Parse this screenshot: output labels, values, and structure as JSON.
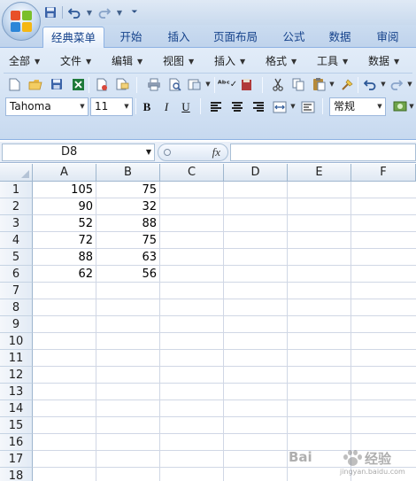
{
  "quick_access": {
    "icons": [
      "save-icon",
      "undo-icon",
      "redo-icon",
      "customize-icon"
    ]
  },
  "tabs": [
    {
      "label": "经典菜单",
      "active": true
    },
    {
      "label": "开始",
      "active": false
    },
    {
      "label": "插入",
      "active": false
    },
    {
      "label": "页面布局",
      "active": false
    },
    {
      "label": "公式",
      "active": false
    },
    {
      "label": "数据",
      "active": false
    },
    {
      "label": "审阅",
      "active": false
    }
  ],
  "menus": [
    "全部",
    "文件",
    "编辑",
    "视图",
    "插入",
    "格式",
    "工具",
    "数据"
  ],
  "toolbar": {
    "icons": [
      "new-icon",
      "open-icon",
      "save-icon",
      "excel-icon",
      "permission-icon",
      "print-icon",
      "print-preview-icon",
      "spellcheck-icon",
      "research-icon",
      "cut-icon",
      "copy-icon",
      "paste-icon",
      "format-painter-icon",
      "undo-icon",
      "redo-icon",
      "chart-icon"
    ]
  },
  "format": {
    "font_name": "Tahoma",
    "font_size": "11",
    "bold_label": "B",
    "italic_label": "I",
    "underline_label": "U",
    "number_format": "常规"
  },
  "formula_bar": {
    "name_box": "D8",
    "fx_label": "fx",
    "formula": ""
  },
  "sheet": {
    "columns": [
      "A",
      "B",
      "C",
      "D",
      "E",
      "F"
    ],
    "rows": [
      "1",
      "2",
      "3",
      "4",
      "5",
      "6",
      "7",
      "8",
      "9",
      "10",
      "11",
      "12",
      "13",
      "14",
      "15",
      "16",
      "17",
      "18"
    ],
    "cells": [
      {
        "row": 1,
        "col": "A",
        "value": "105"
      },
      {
        "row": 1,
        "col": "B",
        "value": "75"
      },
      {
        "row": 2,
        "col": "A",
        "value": "90"
      },
      {
        "row": 2,
        "col": "B",
        "value": "32"
      },
      {
        "row": 3,
        "col": "A",
        "value": "52"
      },
      {
        "row": 3,
        "col": "B",
        "value": "88"
      },
      {
        "row": 4,
        "col": "A",
        "value": "72"
      },
      {
        "row": 4,
        "col": "B",
        "value": "75"
      },
      {
        "row": 5,
        "col": "A",
        "value": "88"
      },
      {
        "row": 5,
        "col": "B",
        "value": "63"
      },
      {
        "row": 6,
        "col": "A",
        "value": "62"
      },
      {
        "row": 6,
        "col": "B",
        "value": "56"
      }
    ],
    "selected_cell": "D8"
  },
  "watermark": {
    "left_text": "Bai",
    "right_text": "经验",
    "url": "jingyan.baidu.com"
  }
}
